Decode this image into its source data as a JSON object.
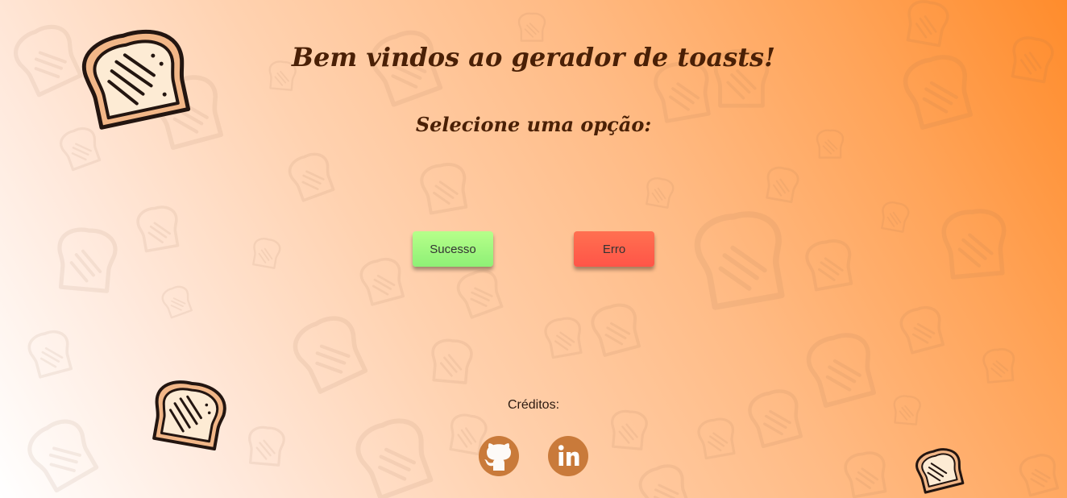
{
  "header": {
    "title": "Bem vindos ao gerador de toasts!",
    "subtitle": "Selecione uma opção:"
  },
  "buttons": {
    "success_label": "Sucesso",
    "error_label": "Erro"
  },
  "footer": {
    "credits_label": "Créditos:",
    "links": [
      {
        "icon": "github-icon"
      },
      {
        "icon": "linkedin-icon"
      }
    ]
  },
  "colors": {
    "title_text": "#4a2006",
    "success_button": "#a6f77e",
    "error_button": "#ff5f4c",
    "social_icon": "#c97a3a",
    "background_start": "#ffffff",
    "background_end": "#ff8c2c"
  }
}
